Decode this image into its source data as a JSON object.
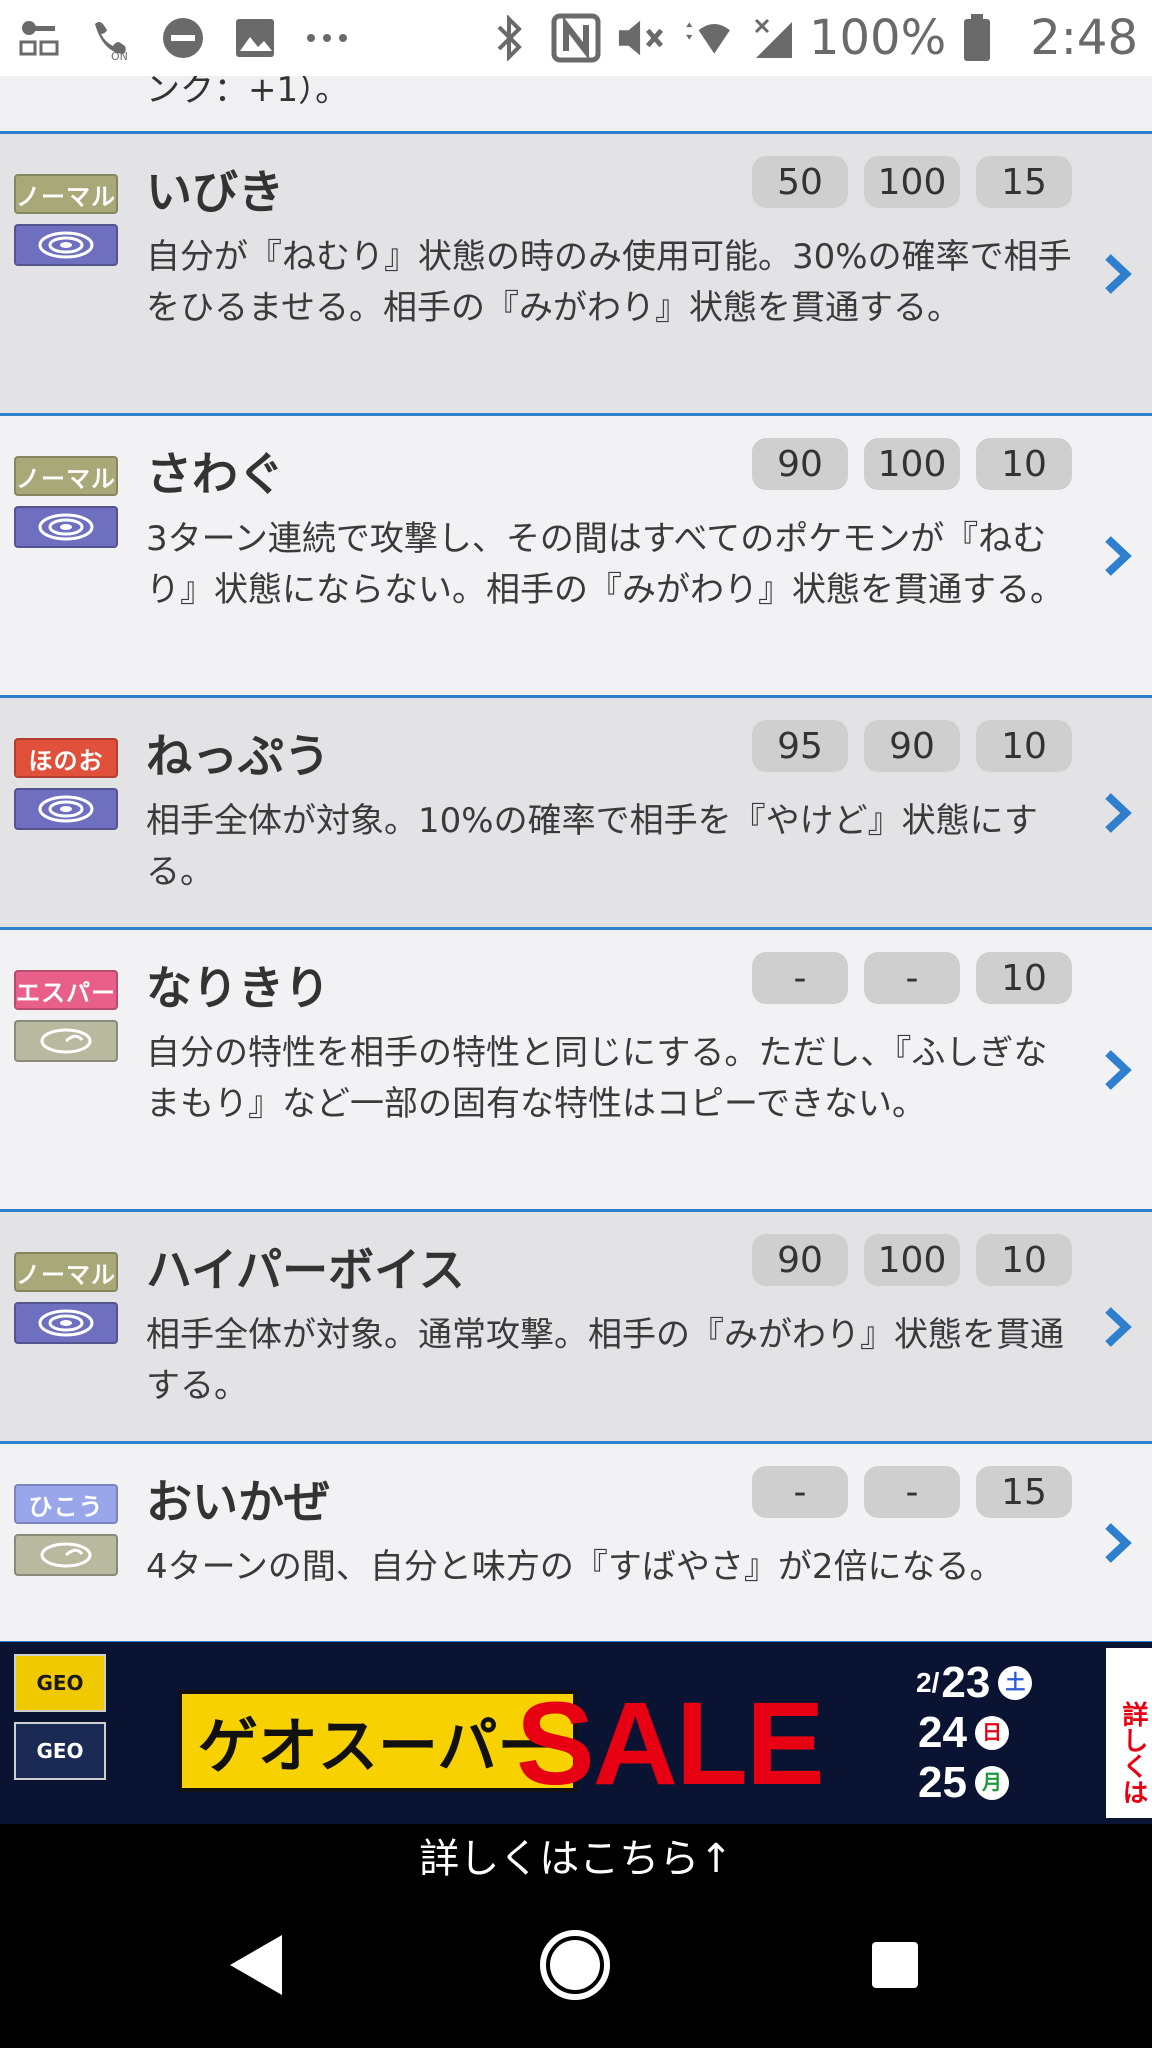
{
  "statusbar": {
    "battery": "100%",
    "time": "2:48",
    "icons": [
      "key-mail-icon",
      "wifi-calling-on-icon",
      "do-not-disturb-icon",
      "image-icon",
      "more-dots-icon",
      "bluetooth-icon",
      "nfc-icon",
      "mute-icon",
      "wifi-icon",
      "signal-icon",
      "battery-icon"
    ]
  },
  "top_fragment": "ンク：+1）。",
  "moves": [
    {
      "type": "ノーマル",
      "type_color": "#a8a878",
      "category": "special",
      "name": "いびき",
      "stats": [
        "50",
        "100",
        "15"
      ],
      "desc": "自分が『ねむり』状態の時のみ使用可能。30%の確率で相手をひるませる。相手の『みがわり』状態を貫通する。"
    },
    {
      "type": "ノーマル",
      "type_color": "#a8a878",
      "category": "special",
      "name": "さわぐ",
      "stats": [
        "90",
        "100",
        "10"
      ],
      "desc": "3ターン連続で攻撃し、その間はすべてのポケモンが『ねむり』状態にならない。相手の『みがわり』状態を貫通する。"
    },
    {
      "type": "ほのお",
      "type_color": "#e0503a",
      "category": "special",
      "name": "ねっぷう",
      "stats": [
        "95",
        "90",
        "10"
      ],
      "desc": "相手全体が対象。10%の確率で相手を『やけど』状態にする。"
    },
    {
      "type": "エスパー",
      "type_color": "#e8608a",
      "category": "status",
      "name": "なりきり",
      "stats": [
        "-",
        "-",
        "10"
      ],
      "desc": "自分の特性を相手の特性と同じにする。ただし、『ふしぎなまもり』など一部の固有な特性はコピーできない。"
    },
    {
      "type": "ノーマル",
      "type_color": "#a8a878",
      "category": "special",
      "name": "ハイパーボイス",
      "stats": [
        "90",
        "100",
        "10"
      ],
      "desc": "相手全体が対象。通常攻撃。相手の『みがわり』状態を貫通する。"
    },
    {
      "type": "ひこう",
      "type_color": "#9aa6ea",
      "category": "status",
      "name": "おいかぜ",
      "stats": [
        "-",
        "-",
        "15"
      ],
      "desc": "4ターンの間、自分と味方の『すばやさ』が2倍になる。"
    }
  ],
  "banner": {
    "logo_top": "GEO",
    "logo_bottom": "GEO",
    "title": "ゲオスーパー",
    "sale": "SALE",
    "dates": [
      {
        "prefix": "2/",
        "num": "23",
        "day": "土",
        "day_color": "#2a5bd7"
      },
      {
        "prefix": "",
        "num": "24",
        "day": "日",
        "day_color": "#e60012"
      },
      {
        "prefix": "",
        "num": "25",
        "day": "月",
        "day_color": "#1d9a3c"
      }
    ],
    "side": "詳しくは"
  },
  "subtext": "詳しくはこちら↑",
  "colors": {
    "accent": "#2f7fcf",
    "special": "#6f6fbf",
    "status": "#b9b9a0"
  }
}
